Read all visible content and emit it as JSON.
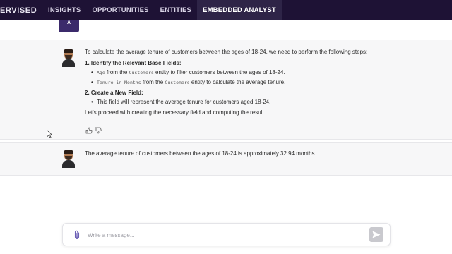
{
  "topbar": {
    "brand": "ERVISED",
    "nav": [
      {
        "label": "INSIGHTS",
        "active": false
      },
      {
        "label": "OPPORTUNITIES",
        "active": false
      },
      {
        "label": "ENTITIES",
        "active": false
      },
      {
        "label": "EMBEDDED ANALYST",
        "active": true
      }
    ]
  },
  "user_avatar": {
    "initial": "A"
  },
  "messages": [
    {
      "intro": "To calculate the average tenure of customers between the ages of 18-24, we need to perform the following steps:",
      "steps": [
        {
          "title": "1. Identify the Relevant Base Fields:",
          "bullets": [
            {
              "field": "Age",
              "mid": " from the ",
              "entity": "Customers",
              "rest": " entity to filter customers between the ages of 18-24."
            },
            {
              "field": "Tenure in Months",
              "mid": " from the ",
              "entity": "Customers",
              "rest": " entity to calculate the average tenure."
            }
          ]
        },
        {
          "title": "2. Create a New Field:",
          "bullets": [
            {
              "text": "This field will represent the average tenure for customers aged 18-24."
            }
          ]
        }
      ],
      "closing": "Let's proceed with creating the necessary field and computing the result."
    },
    {
      "text": "The average tenure of customers between the ages of 18-24 is approximately 32.94 months."
    }
  ],
  "composer": {
    "placeholder": "Write a message...",
    "value": ""
  },
  "colors": {
    "topbar_bg": "#1e1235",
    "accent": "#3b2a6b",
    "attach_icon": "#6b5fb5",
    "send_disabled": "#c9c9ce"
  },
  "icons": [
    "thumbs-up-icon",
    "thumbs-down-icon",
    "paperclip-icon",
    "send-icon",
    "mouse-cursor-icon"
  ]
}
